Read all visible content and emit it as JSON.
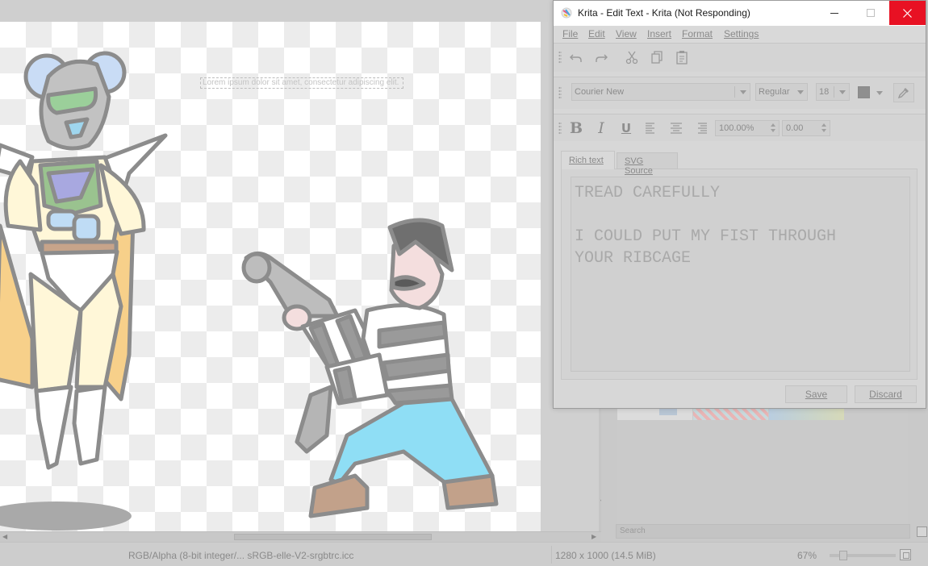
{
  "canvas": {
    "text_shape": "Lorem ipsum dolor sit amet, consectetur adipiscing elit."
  },
  "dialog": {
    "title": "Krita - Edit Text - Krita (Not Responding)",
    "menu": [
      "File",
      "Edit",
      "View",
      "Insert",
      "Format",
      "Settings"
    ],
    "toolbar1": [
      "undo-icon",
      "redo-icon",
      "cut-icon",
      "copy-icon",
      "paste-icon"
    ],
    "font": {
      "family": "Courier New",
      "style": "Regular",
      "size": "18",
      "color": "#8f8f8f"
    },
    "format_toolbar": {
      "icons": [
        "bold-icon",
        "italic-icon",
        "underline-icon",
        "align-left-icon",
        "align-center-icon",
        "align-right-icon"
      ],
      "line_height": "100.00%",
      "letter_spacing": "0.00"
    },
    "tabs": [
      "Rich text",
      "SVG Source"
    ],
    "active_tab": "Rich text",
    "editor_text": "TREAD CAREFULLY\n\nI COULD PUT MY FIST THROUGH\nYOUR RIBCAGE",
    "buttons": {
      "save": "Save",
      "discard": "Discard"
    }
  },
  "docker": {
    "search_placeholder": "Search"
  },
  "statusbar": {
    "color_profile": "RGB/Alpha (8-bit integer/... sRGB-elle-V2-srgbtrc.icc",
    "image_size": "1280 x 1000 (14.5 MiB)",
    "zoom": "67%",
    "zoom_level": 0.17
  },
  "colors": {
    "close_button": "#e81123",
    "trousers": "#8fdef5",
    "cape": "#f7d08a",
    "costume_body": "#fff7d8"
  }
}
